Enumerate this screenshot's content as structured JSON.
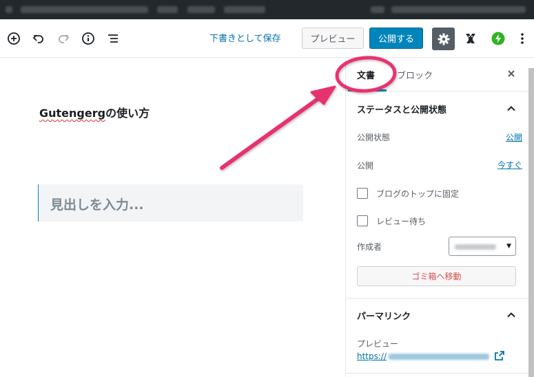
{
  "toolbar": {
    "save_draft_label": "下書きとして保存",
    "preview_label": "プレビュー",
    "publish_label": "公開する"
  },
  "editor": {
    "title_underlined": "Gutengerg",
    "title_rest": "の使い方",
    "heading_placeholder": "見出しを入力..."
  },
  "sidebar": {
    "tabs": [
      {
        "label": "文書",
        "active": true
      },
      {
        "label": "ブロック",
        "active": false
      }
    ],
    "status_panel": {
      "title": "ステータスと公開状態",
      "visibility_label": "公開状態",
      "visibility_value": "公開",
      "publish_label": "公開",
      "publish_value": "今すぐ",
      "stick_to_top_label": "ブログのトップに固定",
      "pending_review_label": "レビュー待ち",
      "author_label": "作成者",
      "trash_label": "ゴミ箱へ移動"
    },
    "permalink_panel": {
      "title": "パーマリンク",
      "preview_label": "プレビュー",
      "url_prefix": "https://"
    }
  },
  "colors": {
    "admin_bar": "#23282d",
    "accent_blue": "#0085ba",
    "link_blue": "#0073aa",
    "settings_button": "#555d66",
    "jetpack_green": "#2fb41f",
    "trash_red": "#d94f4f",
    "annotation_pink": "#e8336d"
  },
  "icons": [
    "add-block-icon",
    "undo-icon",
    "redo-icon",
    "info-icon",
    "outline-icon",
    "gear-icon",
    "yoast-icon",
    "jetpack-icon",
    "more-menu-icon",
    "close-icon",
    "chevron-up-icon",
    "external-link-icon"
  ]
}
